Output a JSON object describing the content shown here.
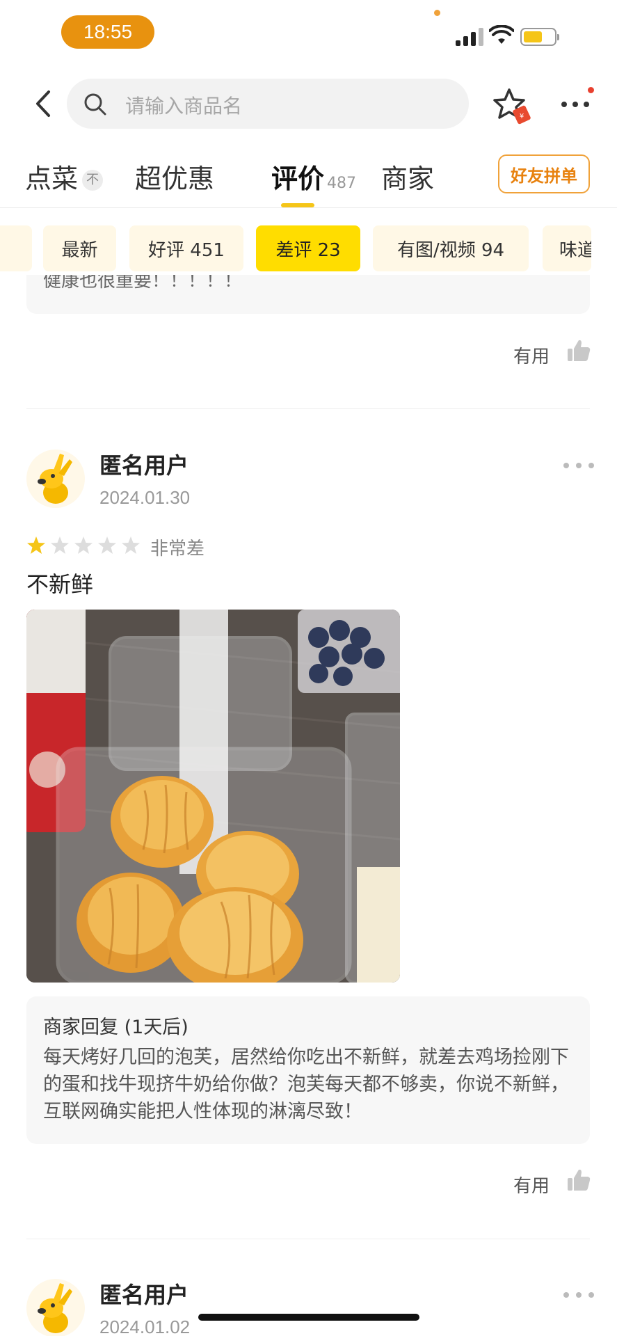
{
  "status_bar": {
    "time": "18:55"
  },
  "header": {
    "search_placeholder": "请输入商品名"
  },
  "tabs": [
    {
      "label": "点菜",
      "badge": "不"
    },
    {
      "label": "超优惠"
    },
    {
      "label": "评价",
      "count": "487"
    },
    {
      "label": "商家"
    }
  ],
  "pin_button": "好友拼单",
  "filters": [
    {
      "label": "最新"
    },
    {
      "label": "好评 451"
    },
    {
      "label": "差评 23",
      "active": true
    },
    {
      "label": "有图/视频 94"
    },
    {
      "label": "味道"
    }
  ],
  "previous_review": {
    "tail_text": "健康也很重要！！！！！",
    "useful_label": "有用"
  },
  "reviews": [
    {
      "user": "匿名用户",
      "date": "2024.01.30",
      "rating": 1,
      "rating_max": 5,
      "rating_label": "非常差",
      "text": "不新鲜",
      "reply_title": "商家回复 (1天后)",
      "reply_text": "每天烤好几回的泡芙，居然给你吃出不新鲜，就差去鸡场捡刚下的蛋和找牛现挤牛奶给你做？泡芙每天都不够卖，你说不新鲜，互联网确实能把人性体现的淋漓尽致！",
      "useful_label": "有用"
    },
    {
      "user": "匿名用户",
      "date": "2024.01.02"
    }
  ],
  "colors": {
    "accent_yellow": "#ffdd00",
    "time_pill": "#e8920f",
    "pin_button_border": "#f0a23a",
    "star_filled": "#f5c518",
    "star_empty": "#dddddd"
  },
  "icons": [
    "back-icon",
    "search-icon",
    "favorite-star-icon",
    "more-icon",
    "thumbs-up-icon",
    "kangaroo-avatar"
  ]
}
